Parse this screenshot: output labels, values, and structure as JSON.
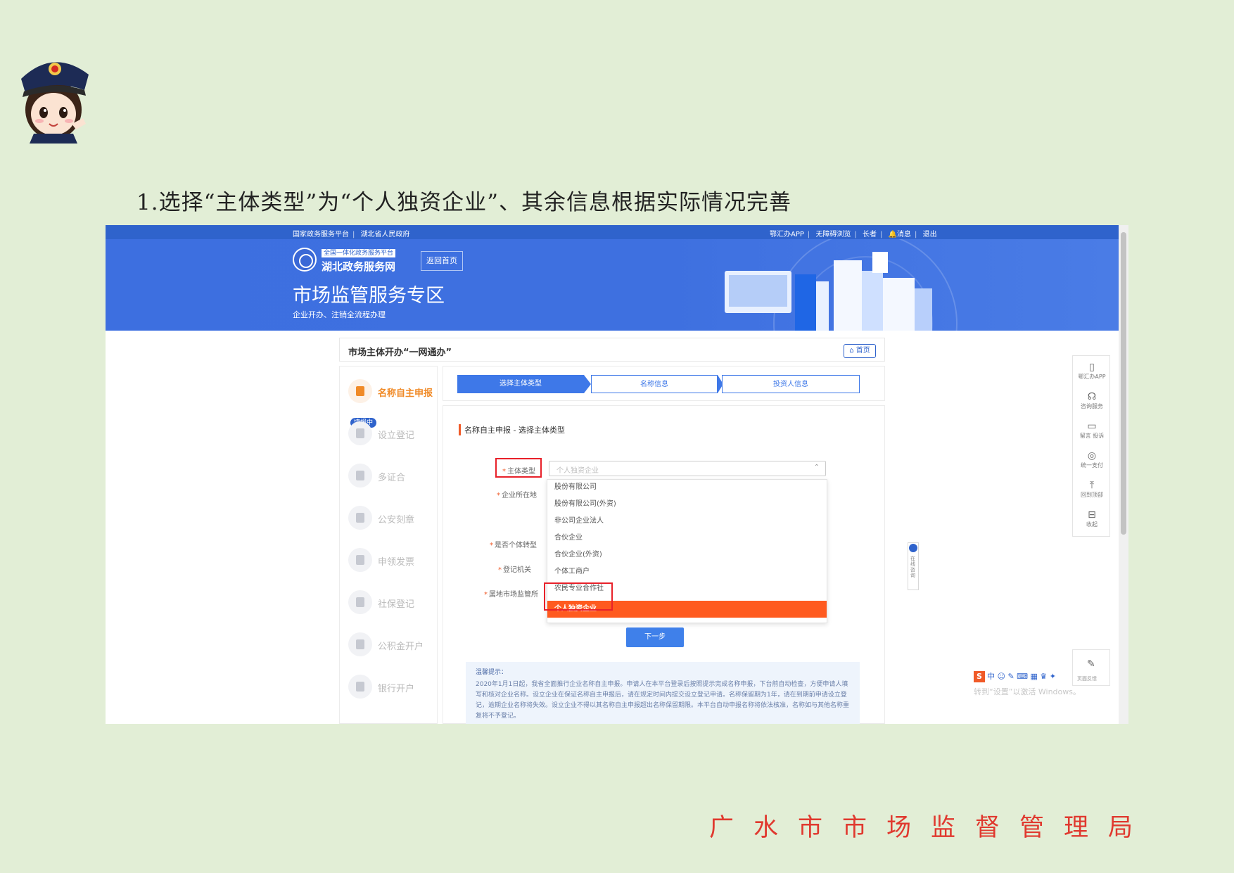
{
  "heading": "1.选择“主体类型”为“个人独资企业”、其余信息根据实际情况完善",
  "topbar": {
    "left_links": [
      "国家政务服务平台",
      "湖北省人民政府"
    ],
    "right_links": [
      "鄂汇办APP",
      "无障碍浏览",
      "长者",
      "消息",
      "退出"
    ]
  },
  "banner": {
    "portal_small": "全国一体化政务服务平台",
    "portal_name": "湖北政务服务网",
    "back_home": "返回首页",
    "title": "市场监管服务专区",
    "subtitle": "企业开办、注销全流程办理"
  },
  "crumb": {
    "title": "市场主体开办“一网通办”",
    "home_button": "首页"
  },
  "nav": {
    "badge": "填报中",
    "items": [
      "名称自主申报",
      "设立登记",
      "多证合",
      "公安刻章",
      "申领发票",
      "社保登记",
      "公积金开户",
      "银行开户"
    ]
  },
  "steps": [
    "选择主体类型",
    "名称信息",
    "投资人信息"
  ],
  "form": {
    "title": "名称自主申报 - 选择主体类型",
    "labels": [
      "主体类型",
      "企业所在地",
      "是否个体转型",
      "登记机关",
      "属地市场监管所"
    ],
    "select_placeholder": "个人独资企业",
    "options": [
      "股份有限公司",
      "股份有限公司(外资)",
      "非公司企业法人",
      "合伙企业",
      "合伙企业(外资)",
      "个体工商户",
      "农民专业合作社",
      "个人独资企业"
    ],
    "selected_option": "个人独资企业",
    "next_button": "下一步",
    "tip_title": "温馨提示：",
    "tip_text": "2020年1月1日起，我省全面推行企业名称自主申报。申请人在本平台登录后按照提示完成名称申报，下台前自动检查，方便申请人填写和核对企业名称。设立企业在保证名称自主申报后，请在规定时间内提交设立登记申请。名称保留期为1年，请在到期前申请设立登记，逾期企业名称将失效。设立企业不得以其名称自主申报超出名称保留期限。本平台自动申报名称将依法核准，名称如与其他名称重复将不予登记。"
  },
  "right_toolbar": [
    {
      "icon": "phone-icon",
      "label": "鄂汇办APP"
    },
    {
      "icon": "headset-icon",
      "label": "咨询服务"
    },
    {
      "icon": "message-icon",
      "label": "留言 投诉"
    },
    {
      "icon": "pay-icon",
      "label": "统一支付"
    },
    {
      "icon": "up-arrow-icon",
      "label": "回到顶部"
    },
    {
      "icon": "collapse-icon",
      "label": "收起"
    }
  ],
  "side_tab": "在线咨询",
  "feedback_label": "页面反馈",
  "ime_text": "中",
  "windows_watermark": "转到“设置”以激活 Windows。",
  "org_name": "广水市市场监督管理局"
}
